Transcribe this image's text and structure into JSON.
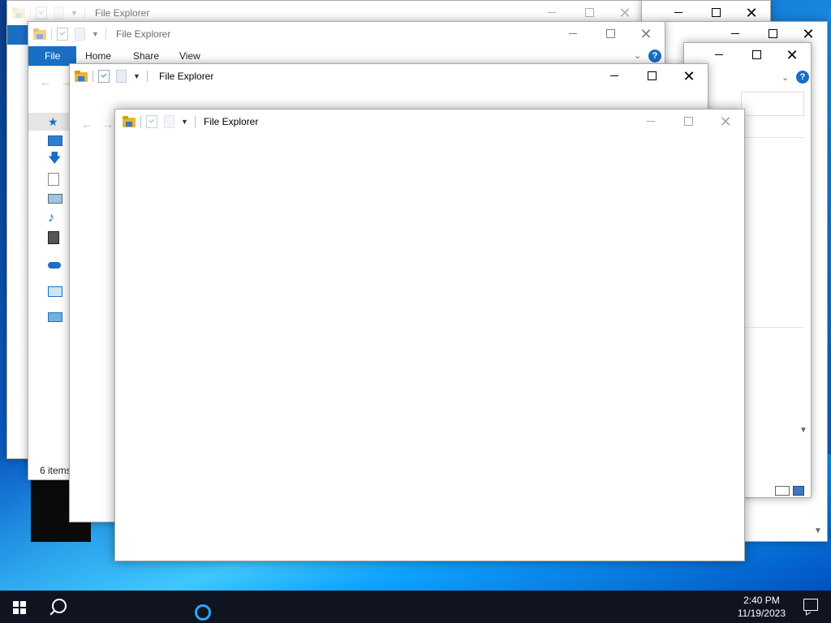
{
  "window": {
    "title": "File Explorer",
    "controls": {
      "minimize": "—",
      "maximize": "☐",
      "close": "✕"
    }
  },
  "ribbon": {
    "tabs": [
      "File",
      "Home",
      "Share",
      "View"
    ],
    "help": "?"
  },
  "status": {
    "items_count": "6 items"
  },
  "taskbar": {
    "time": "2:40 PM",
    "date": "11/19/2023"
  },
  "icons": [
    "folder-icon",
    "properties-icon",
    "new-folder-icon",
    "customize-dropdown-icon",
    "quick-access-star-icon",
    "desktop-icon",
    "downloads-icon",
    "documents-icon",
    "pictures-icon",
    "music-icon",
    "videos-icon",
    "onedrive-icon",
    "this-pc-icon",
    "network-icon",
    "windows-start-icon",
    "search-icon",
    "cortana-icon",
    "notification-icon"
  ],
  "colors": {
    "accent": "#1a6fc4",
    "taskbar": "#101420"
  }
}
